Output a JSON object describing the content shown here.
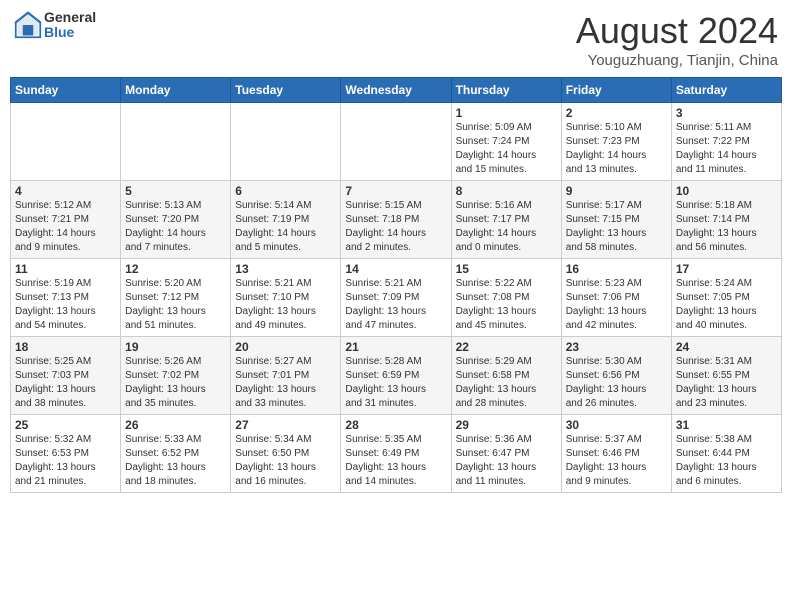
{
  "header": {
    "logo_general": "General",
    "logo_blue": "Blue",
    "month_title": "August 2024",
    "location": "Youguzhuang, Tianjin, China"
  },
  "weekdays": [
    "Sunday",
    "Monday",
    "Tuesday",
    "Wednesday",
    "Thursday",
    "Friday",
    "Saturday"
  ],
  "weeks": [
    [
      {
        "day": "",
        "info": ""
      },
      {
        "day": "",
        "info": ""
      },
      {
        "day": "",
        "info": ""
      },
      {
        "day": "",
        "info": ""
      },
      {
        "day": "1",
        "info": "Sunrise: 5:09 AM\nSunset: 7:24 PM\nDaylight: 14 hours\nand 15 minutes."
      },
      {
        "day": "2",
        "info": "Sunrise: 5:10 AM\nSunset: 7:23 PM\nDaylight: 14 hours\nand 13 minutes."
      },
      {
        "day": "3",
        "info": "Sunrise: 5:11 AM\nSunset: 7:22 PM\nDaylight: 14 hours\nand 11 minutes."
      }
    ],
    [
      {
        "day": "4",
        "info": "Sunrise: 5:12 AM\nSunset: 7:21 PM\nDaylight: 14 hours\nand 9 minutes."
      },
      {
        "day": "5",
        "info": "Sunrise: 5:13 AM\nSunset: 7:20 PM\nDaylight: 14 hours\nand 7 minutes."
      },
      {
        "day": "6",
        "info": "Sunrise: 5:14 AM\nSunset: 7:19 PM\nDaylight: 14 hours\nand 5 minutes."
      },
      {
        "day": "7",
        "info": "Sunrise: 5:15 AM\nSunset: 7:18 PM\nDaylight: 14 hours\nand 2 minutes."
      },
      {
        "day": "8",
        "info": "Sunrise: 5:16 AM\nSunset: 7:17 PM\nDaylight: 14 hours\nand 0 minutes."
      },
      {
        "day": "9",
        "info": "Sunrise: 5:17 AM\nSunset: 7:15 PM\nDaylight: 13 hours\nand 58 minutes."
      },
      {
        "day": "10",
        "info": "Sunrise: 5:18 AM\nSunset: 7:14 PM\nDaylight: 13 hours\nand 56 minutes."
      }
    ],
    [
      {
        "day": "11",
        "info": "Sunrise: 5:19 AM\nSunset: 7:13 PM\nDaylight: 13 hours\nand 54 minutes."
      },
      {
        "day": "12",
        "info": "Sunrise: 5:20 AM\nSunset: 7:12 PM\nDaylight: 13 hours\nand 51 minutes."
      },
      {
        "day": "13",
        "info": "Sunrise: 5:21 AM\nSunset: 7:10 PM\nDaylight: 13 hours\nand 49 minutes."
      },
      {
        "day": "14",
        "info": "Sunrise: 5:21 AM\nSunset: 7:09 PM\nDaylight: 13 hours\nand 47 minutes."
      },
      {
        "day": "15",
        "info": "Sunrise: 5:22 AM\nSunset: 7:08 PM\nDaylight: 13 hours\nand 45 minutes."
      },
      {
        "day": "16",
        "info": "Sunrise: 5:23 AM\nSunset: 7:06 PM\nDaylight: 13 hours\nand 42 minutes."
      },
      {
        "day": "17",
        "info": "Sunrise: 5:24 AM\nSunset: 7:05 PM\nDaylight: 13 hours\nand 40 minutes."
      }
    ],
    [
      {
        "day": "18",
        "info": "Sunrise: 5:25 AM\nSunset: 7:03 PM\nDaylight: 13 hours\nand 38 minutes."
      },
      {
        "day": "19",
        "info": "Sunrise: 5:26 AM\nSunset: 7:02 PM\nDaylight: 13 hours\nand 35 minutes."
      },
      {
        "day": "20",
        "info": "Sunrise: 5:27 AM\nSunset: 7:01 PM\nDaylight: 13 hours\nand 33 minutes."
      },
      {
        "day": "21",
        "info": "Sunrise: 5:28 AM\nSunset: 6:59 PM\nDaylight: 13 hours\nand 31 minutes."
      },
      {
        "day": "22",
        "info": "Sunrise: 5:29 AM\nSunset: 6:58 PM\nDaylight: 13 hours\nand 28 minutes."
      },
      {
        "day": "23",
        "info": "Sunrise: 5:30 AM\nSunset: 6:56 PM\nDaylight: 13 hours\nand 26 minutes."
      },
      {
        "day": "24",
        "info": "Sunrise: 5:31 AM\nSunset: 6:55 PM\nDaylight: 13 hours\nand 23 minutes."
      }
    ],
    [
      {
        "day": "25",
        "info": "Sunrise: 5:32 AM\nSunset: 6:53 PM\nDaylight: 13 hours\nand 21 minutes."
      },
      {
        "day": "26",
        "info": "Sunrise: 5:33 AM\nSunset: 6:52 PM\nDaylight: 13 hours\nand 18 minutes."
      },
      {
        "day": "27",
        "info": "Sunrise: 5:34 AM\nSunset: 6:50 PM\nDaylight: 13 hours\nand 16 minutes."
      },
      {
        "day": "28",
        "info": "Sunrise: 5:35 AM\nSunset: 6:49 PM\nDaylight: 13 hours\nand 14 minutes."
      },
      {
        "day": "29",
        "info": "Sunrise: 5:36 AM\nSunset: 6:47 PM\nDaylight: 13 hours\nand 11 minutes."
      },
      {
        "day": "30",
        "info": "Sunrise: 5:37 AM\nSunset: 6:46 PM\nDaylight: 13 hours\nand 9 minutes."
      },
      {
        "day": "31",
        "info": "Sunrise: 5:38 AM\nSunset: 6:44 PM\nDaylight: 13 hours\nand 6 minutes."
      }
    ]
  ]
}
